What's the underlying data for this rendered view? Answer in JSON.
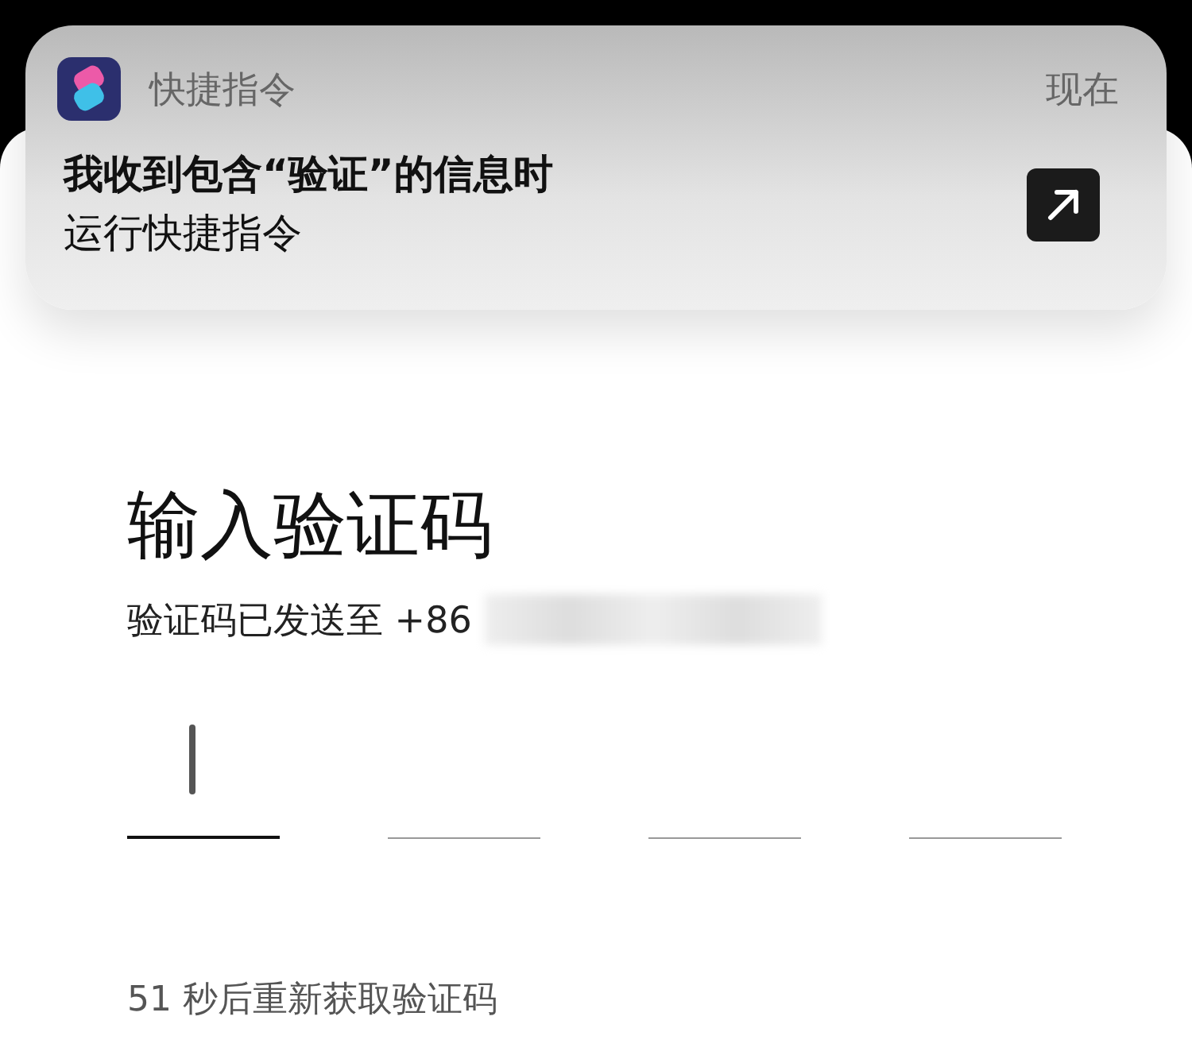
{
  "notification": {
    "app_name": "快捷指令",
    "time": "现在",
    "title": "我收到包含“验证”的信息时",
    "body": "运行快捷指令"
  },
  "verification": {
    "heading": "输入验证码",
    "sent_to": "验证码已发送至 +86",
    "code_boxes": [
      {
        "selected": true
      },
      {
        "selected": false
      },
      {
        "selected": false
      },
      {
        "selected": false
      }
    ],
    "resend": "51 秒后重新获取验证码"
  }
}
